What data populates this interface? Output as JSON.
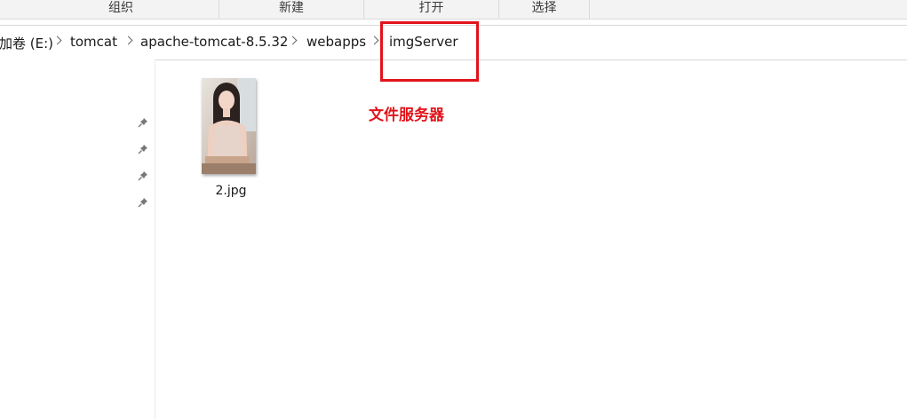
{
  "ribbon": {
    "groups": [
      "组织",
      "新建",
      "打开",
      "选择"
    ]
  },
  "breadcrumb": {
    "drive": "加卷 (E:)",
    "items": [
      "tomcat",
      "apache-tomcat-8.5.32",
      "webapps",
      "imgServer"
    ]
  },
  "files": [
    {
      "name": "2.jpg",
      "icon": "photo-thumbnail"
    }
  ],
  "annotation": {
    "text": "文件服务器",
    "color": "#e1141b"
  },
  "nav": {
    "pinned_icons": [
      "pin-icon",
      "pin-icon",
      "pin-icon",
      "pin-icon"
    ]
  },
  "colors": {
    "highlight": "#e1141b",
    "ribbon_bg": "#f3f3f3"
  }
}
